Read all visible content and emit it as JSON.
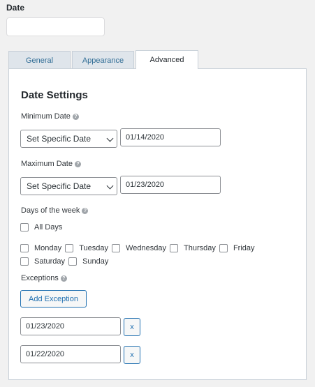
{
  "field": {
    "label": "Date"
  },
  "tabs": [
    {
      "label": "General"
    },
    {
      "label": "Appearance"
    },
    {
      "label": "Advanced",
      "active": true
    }
  ],
  "settings": {
    "heading": "Date Settings",
    "minimum": {
      "label": "Minimum Date",
      "mode": "Set Specific Date",
      "value": "01/14/2020"
    },
    "maximum": {
      "label": "Maximum Date",
      "mode": "Set Specific Date",
      "value": "01/23/2020"
    },
    "days_label": "Days of the week",
    "all_days": "All Days",
    "days": [
      "Monday",
      "Tuesday",
      "Wednesday",
      "Thursday",
      "Friday",
      "Saturday",
      "Sunday"
    ],
    "exceptions_label": "Exceptions",
    "add_exception": "Add Exception",
    "exceptions": [
      {
        "value": "01/23/2020",
        "remove": "x"
      },
      {
        "value": "01/22/2020",
        "remove": "x"
      }
    ]
  },
  "help_glyph": "?",
  "colors": {
    "accent": "#2271b1",
    "tab_bg": "#dfe5eb",
    "tab_text": "#2f6c95"
  }
}
